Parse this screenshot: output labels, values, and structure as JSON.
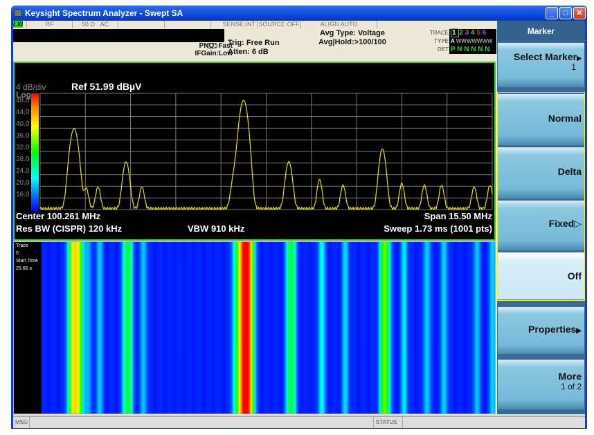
{
  "window": {
    "title": "Keysight Spectrum Analyzer - Swept SA",
    "minimize": "_",
    "maximize": "□",
    "close": "✕"
  },
  "status_row": {
    "lxi": "LXI",
    "input": "RF",
    "impedance": "50 Ω",
    "coupling": "AC",
    "sense": "SENSE:INT",
    "source": "SOURCE OFF",
    "align": "ALIGN AUTO"
  },
  "settings": {
    "pno": "PNO: Fast",
    "ifgain": "IFGain:Low",
    "trig": "Trig: Free Run",
    "atten": "Atten: 6 dB",
    "avg_type": "Avg Type: Voltage",
    "avg_hold": "Avg|Hold:>100/100"
  },
  "trace_panel": {
    "trace_label": "TRACE",
    "type_label": "TYPE",
    "det_label": "DET",
    "traces": [
      "1",
      "2",
      "3",
      "4",
      "5",
      "6"
    ],
    "trace_colors": [
      "#ffff00",
      "#00c8c8",
      "#c040c0",
      "#40d040",
      "#e02040",
      "#6060ff"
    ],
    "type": "A",
    "type_rest": "WWWWWWW",
    "det": [
      "P",
      "N",
      "N",
      "N",
      "N",
      "N"
    ]
  },
  "graph": {
    "scale": "4 dB/div",
    "ref": "Ref 51.99 dBµV",
    "scale_type": "Log",
    "y_labels": [
      "48.0",
      "44.0",
      "40.0",
      "36.0",
      "32.0",
      "28.0",
      "24.0",
      "20.0",
      "16.0"
    ],
    "center": "Center 100.261 MHz",
    "span": "Span 15.50 MHz",
    "rbw": "Res BW (CISPR)  120 kHz",
    "vbw": "VBW 910 kHz",
    "sweep": "Sweep  1.73 ms (1001 pts)",
    "trace_color": "#e8e000",
    "border_color": "#33cc33"
  },
  "waterfall": {
    "trace_label": "Trace",
    "trace_value": "0",
    "start_label": "Start Time",
    "start_value": "25.66 s"
  },
  "bottom": {
    "msg": "MSG",
    "status": "STATUS"
  },
  "softkeys": {
    "menu_title": "Marker",
    "select_marker": "Select Marker",
    "select_marker_value": "1",
    "normal": "Normal",
    "delta": "Delta",
    "fixed": "Fixed",
    "off": "Off",
    "properties": "Properties",
    "more": "More",
    "more_page": "1 of 2",
    "selected": "Off"
  }
}
